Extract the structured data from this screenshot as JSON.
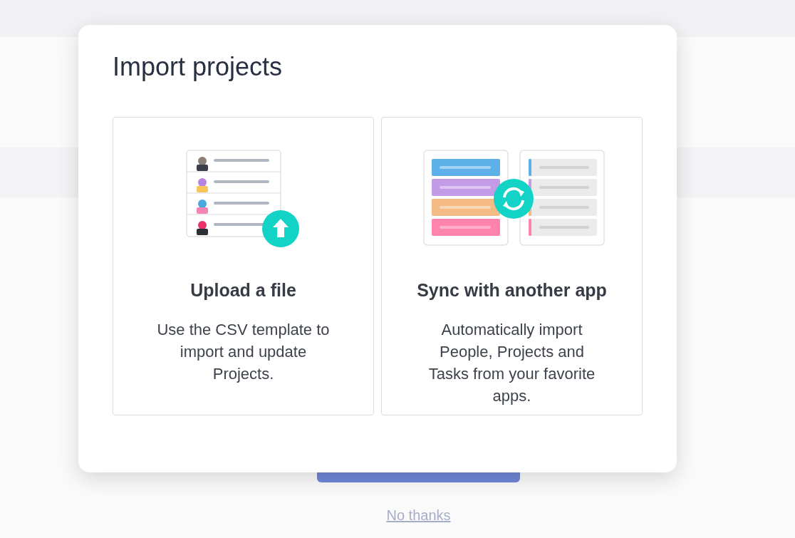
{
  "dialog": {
    "title": "Import projects",
    "options": [
      {
        "kind": "upload",
        "title": "Upload a file",
        "description": "Use the CSV template to import and update Projects."
      },
      {
        "kind": "sync",
        "title": "Sync with another app",
        "description": "Automatically import People, Projects and Tasks from your favorite apps."
      }
    ]
  },
  "link": "No thanks"
}
